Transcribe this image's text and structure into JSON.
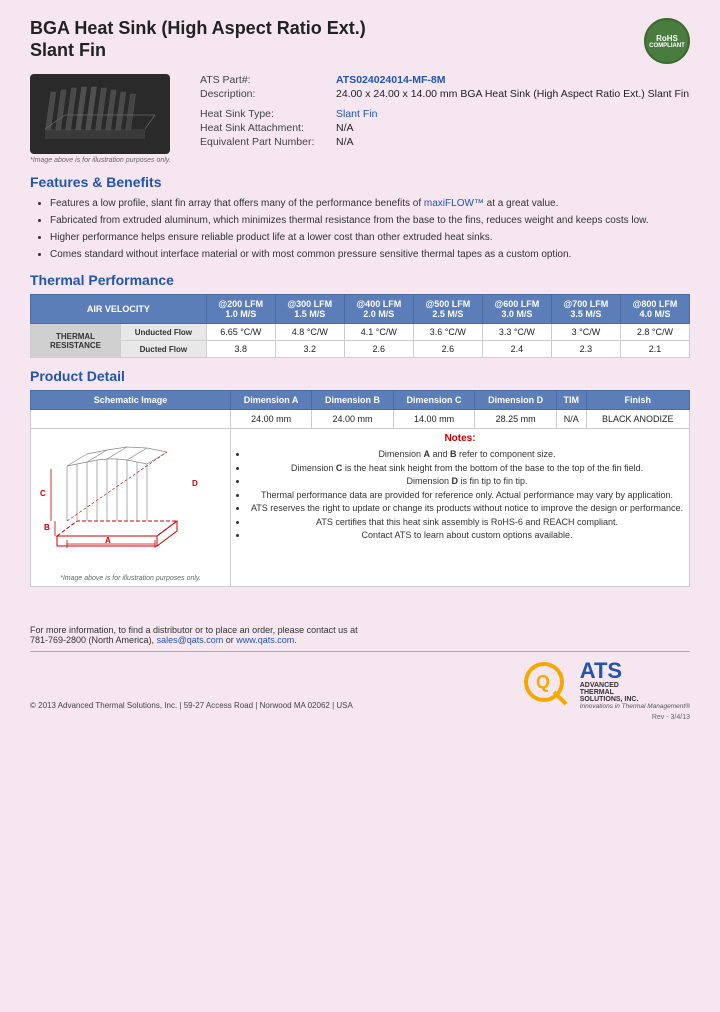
{
  "header": {
    "title_line1": "BGA Heat Sink (High Aspect Ratio Ext.)",
    "title_line2": "Slant Fin",
    "rohs": "RoHS\nCOMPLIANT"
  },
  "product": {
    "part_label": "ATS Part#:",
    "part_number": "ATS024024014-MF-8M",
    "description_label": "Description:",
    "description": "24.00 x 24.00 x 14.00 mm BGA Heat Sink (High Aspect Ratio Ext.) Slant Fin",
    "type_label": "Heat Sink Type:",
    "type_value": "Slant Fin",
    "attachment_label": "Heat Sink Attachment:",
    "attachment_value": "N/A",
    "equiv_label": "Equivalent Part Number:",
    "equiv_value": "N/A",
    "image_note": "*Image above is for illustration purposes only."
  },
  "features": {
    "title": "Features & Benefits",
    "items": [
      "Features a low profile, slant fin array that offers many of the performance benefits of maxiFLOW™ at a great value.",
      "Fabricated from extruded aluminum, which minimizes thermal resistance from the base to the fins, reduces weight and keeps costs low.",
      "Higher performance helps ensure reliable product life at a lower cost than other extruded heat sinks.",
      "Comes standard without interface material or with most common pressure sensitive thermal tapes as a custom option."
    ],
    "highlight_text": "maxiFLOW™"
  },
  "thermal": {
    "title": "Thermal Performance",
    "col_headers": [
      {
        "line1": "AIR VELOCITY",
        "line2": ""
      },
      {
        "line1": "@200 LFM",
        "line2": "1.0 M/S"
      },
      {
        "line1": "@300 LFM",
        "line2": "1.5 M/S"
      },
      {
        "line1": "@400 LFM",
        "line2": "2.0 M/S"
      },
      {
        "line1": "@500 LFM",
        "line2": "2.5 M/S"
      },
      {
        "line1": "@600 LFM",
        "line2": "3.0 M/S"
      },
      {
        "line1": "@700 LFM",
        "line2": "3.5 M/S"
      },
      {
        "line1": "@800 LFM",
        "line2": "4.0 M/S"
      }
    ],
    "row_group_label": "THERMAL RESISTANCE",
    "rows": [
      {
        "label": "Unducted Flow",
        "values": [
          "6.65 °C/W",
          "4.8 °C/W",
          "4.1 °C/W",
          "3.6 °C/W",
          "3.3 °C/W",
          "3 °C/W",
          "2.8 °C/W"
        ]
      },
      {
        "label": "Ducted Flow",
        "values": [
          "3.8",
          "3.2",
          "2.6",
          "2.6",
          "2.4",
          "2.3",
          "2.1"
        ]
      }
    ]
  },
  "product_detail": {
    "title": "Product Detail",
    "col_headers": [
      "Schematic Image",
      "Dimension A",
      "Dimension B",
      "Dimension C",
      "Dimension D",
      "TIM",
      "Finish"
    ],
    "dim_values": [
      "24.00 mm",
      "24.00 mm",
      "14.00 mm",
      "28.25 mm",
      "N/A",
      "BLACK ANODIZE"
    ],
    "notes_title": "Notes:",
    "notes": [
      "Dimension A and B refer to component size.",
      "Dimension C is the heat sink height from the bottom of the base to the top of the fin field.",
      "Dimension D is fin tip to fin tip.",
      "Thermal performance data are provided for reference only. Actual performance may vary by application.",
      "ATS reserves the right to update or change its products without notice to improve the design or performance.",
      "ATS certifies that this heat sink assembly is RoHS-6 and REACH compliant.",
      "Contact ATS to learn about custom options available."
    ],
    "schematic_note": "*Image above is for illustration purposes only."
  },
  "footer": {
    "contact_text": "For more information, to find a distributor or to place an order, please contact us at",
    "phone": "781-769-2800 (North America),",
    "email": "sales@qats.com",
    "email_connector": " or ",
    "website": "www.qats.com",
    "copyright": "© 2013 Advanced Thermal Solutions, Inc.  |  59-27 Access Road  |  Norwood MA   02062  |  USA",
    "ats_big": "ATS",
    "ats_full": "ADVANCED\nTHERMAL\nSOLUTIONS, INC.",
    "ats_tag": "Innovations in Thermal Management®",
    "rev": "Rev - 3/4/13"
  }
}
